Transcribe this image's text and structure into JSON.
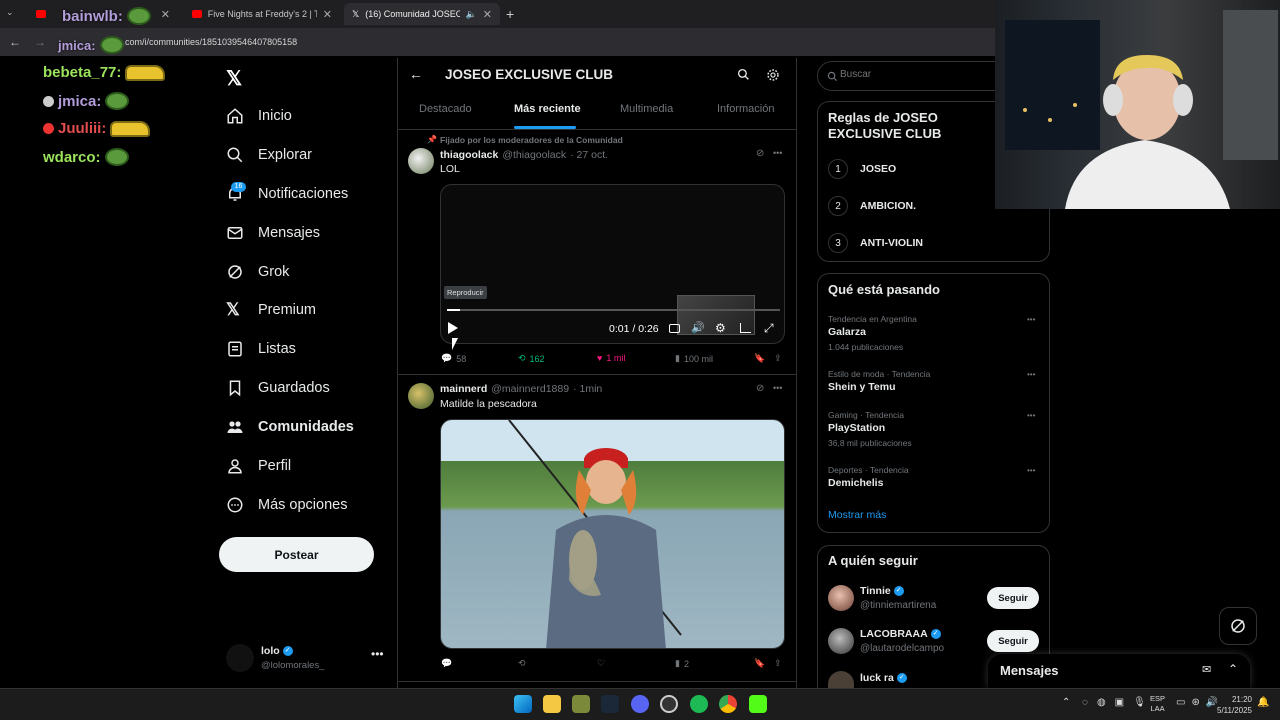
{
  "browser": {
    "tabs": [
      {
        "label": ""
      },
      {
        "label": "Five Nights at Freddy's 2 | Tráile"
      },
      {
        "label": "(16) Comunidad JOSEO EXC"
      }
    ],
    "url": "x.com/i/communities/1851039546407805158"
  },
  "chat": [
    {
      "user": "jmica:"
    },
    {
      "user": "bainwlb:"
    },
    {
      "user": "bebeta_77:"
    },
    {
      "user": "jmica:"
    },
    {
      "user": "Juuliii:"
    },
    {
      "user": "wdarco:"
    }
  ],
  "nav": {
    "items": [
      {
        "label": "Inicio"
      },
      {
        "label": "Explorar"
      },
      {
        "label": "Notificaciones",
        "badge": "16"
      },
      {
        "label": "Mensajes"
      },
      {
        "label": "Grok"
      },
      {
        "label": "Premium"
      },
      {
        "label": "Listas"
      },
      {
        "label": "Guardados"
      },
      {
        "label": "Comunidades"
      },
      {
        "label": "Perfil"
      },
      {
        "label": "Más opciones"
      }
    ],
    "post_label": "Postear",
    "account": {
      "name": "lolo",
      "handle": "@lolomorales_"
    }
  },
  "header": {
    "title": "JOSEO EXCLUSIVE CLUB",
    "tabs": [
      "Destacado",
      "Más reciente",
      "Multimedia",
      "Información"
    ]
  },
  "posts": [
    {
      "pinned": "Fijado por los moderadores de la Comunidad",
      "name": "thiagoolack",
      "handle": "@thiagoolack",
      "time": "· 27 oct.",
      "text": "LOL",
      "video": {
        "tooltip": "Reproducir",
        "time": "0:01 / 0:26",
        "progress": 0.04
      },
      "stats": {
        "replies": "58",
        "reposts": "162",
        "likes": "1 mil",
        "views": "100 mil"
      }
    },
    {
      "name": "mainnerd",
      "handle": "@mainnerd1889",
      "time": "· 1min",
      "text": "Matilde la pescadora",
      "stats": {
        "views": "2"
      }
    }
  ],
  "search": {
    "placeholder": "Buscar"
  },
  "rules": {
    "title": "Reglas de JOSEO EXCLUSIVE CLUB",
    "items": [
      {
        "num": "1",
        "label": "JOSEO"
      },
      {
        "num": "2",
        "label": "AMBICION."
      },
      {
        "num": "3",
        "label": "ANTI-VIOLIN"
      }
    ]
  },
  "trends": {
    "title": "Qué está pasando",
    "items": [
      {
        "context": "Tendencia en Argentina",
        "name": "Galarza",
        "count": "1.044 publicaciones"
      },
      {
        "context": "Estilo de moda · Tendencia",
        "name": "Shein y Temu",
        "count": ""
      },
      {
        "context": "Gaming · Tendencia",
        "name": "PlayStation",
        "count": "36,8 mil publicaciones"
      },
      {
        "context": "Deportes · Tendencia",
        "name": "Demichelis",
        "count": ""
      }
    ],
    "more": "Mostrar más"
  },
  "who_to_follow": {
    "title": "A quién seguir",
    "items": [
      {
        "name": "Tinnie",
        "handle": "@tinniemartirena",
        "button": "Seguir"
      },
      {
        "name": "LACOBRAAA",
        "handle": "@lautarodelcampo",
        "button": "Seguir"
      },
      {
        "name": "luck ra",
        "handle": ""
      }
    ]
  },
  "messages": {
    "label": "Mensajes"
  },
  "taskbar": {
    "lang": "ESP",
    "lang2": "LAA",
    "time": "21:20",
    "date": "5/11/2025"
  },
  "colors": {
    "accent": "#1d9bf0",
    "like": "#f91880",
    "repost": "#00ba7c",
    "bg": "#000000"
  }
}
